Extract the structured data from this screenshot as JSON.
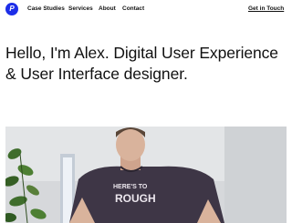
{
  "nav": {
    "logo_letter": "P",
    "links": [
      "Case Studies",
      "Services",
      "About",
      "Contact"
    ],
    "cta": "Get in Touch"
  },
  "hero": {
    "headline": "Hello, I'm Alex. Digital User Experience & User Interface designer."
  },
  "photo": {
    "shirt_text_line1": "HERE'S TO",
    "shirt_text_line2": "ROUGH"
  },
  "colors": {
    "logo": "#1d2ee8",
    "text": "#111111",
    "background": "#ffffff",
    "shirt": "#3e3646"
  }
}
